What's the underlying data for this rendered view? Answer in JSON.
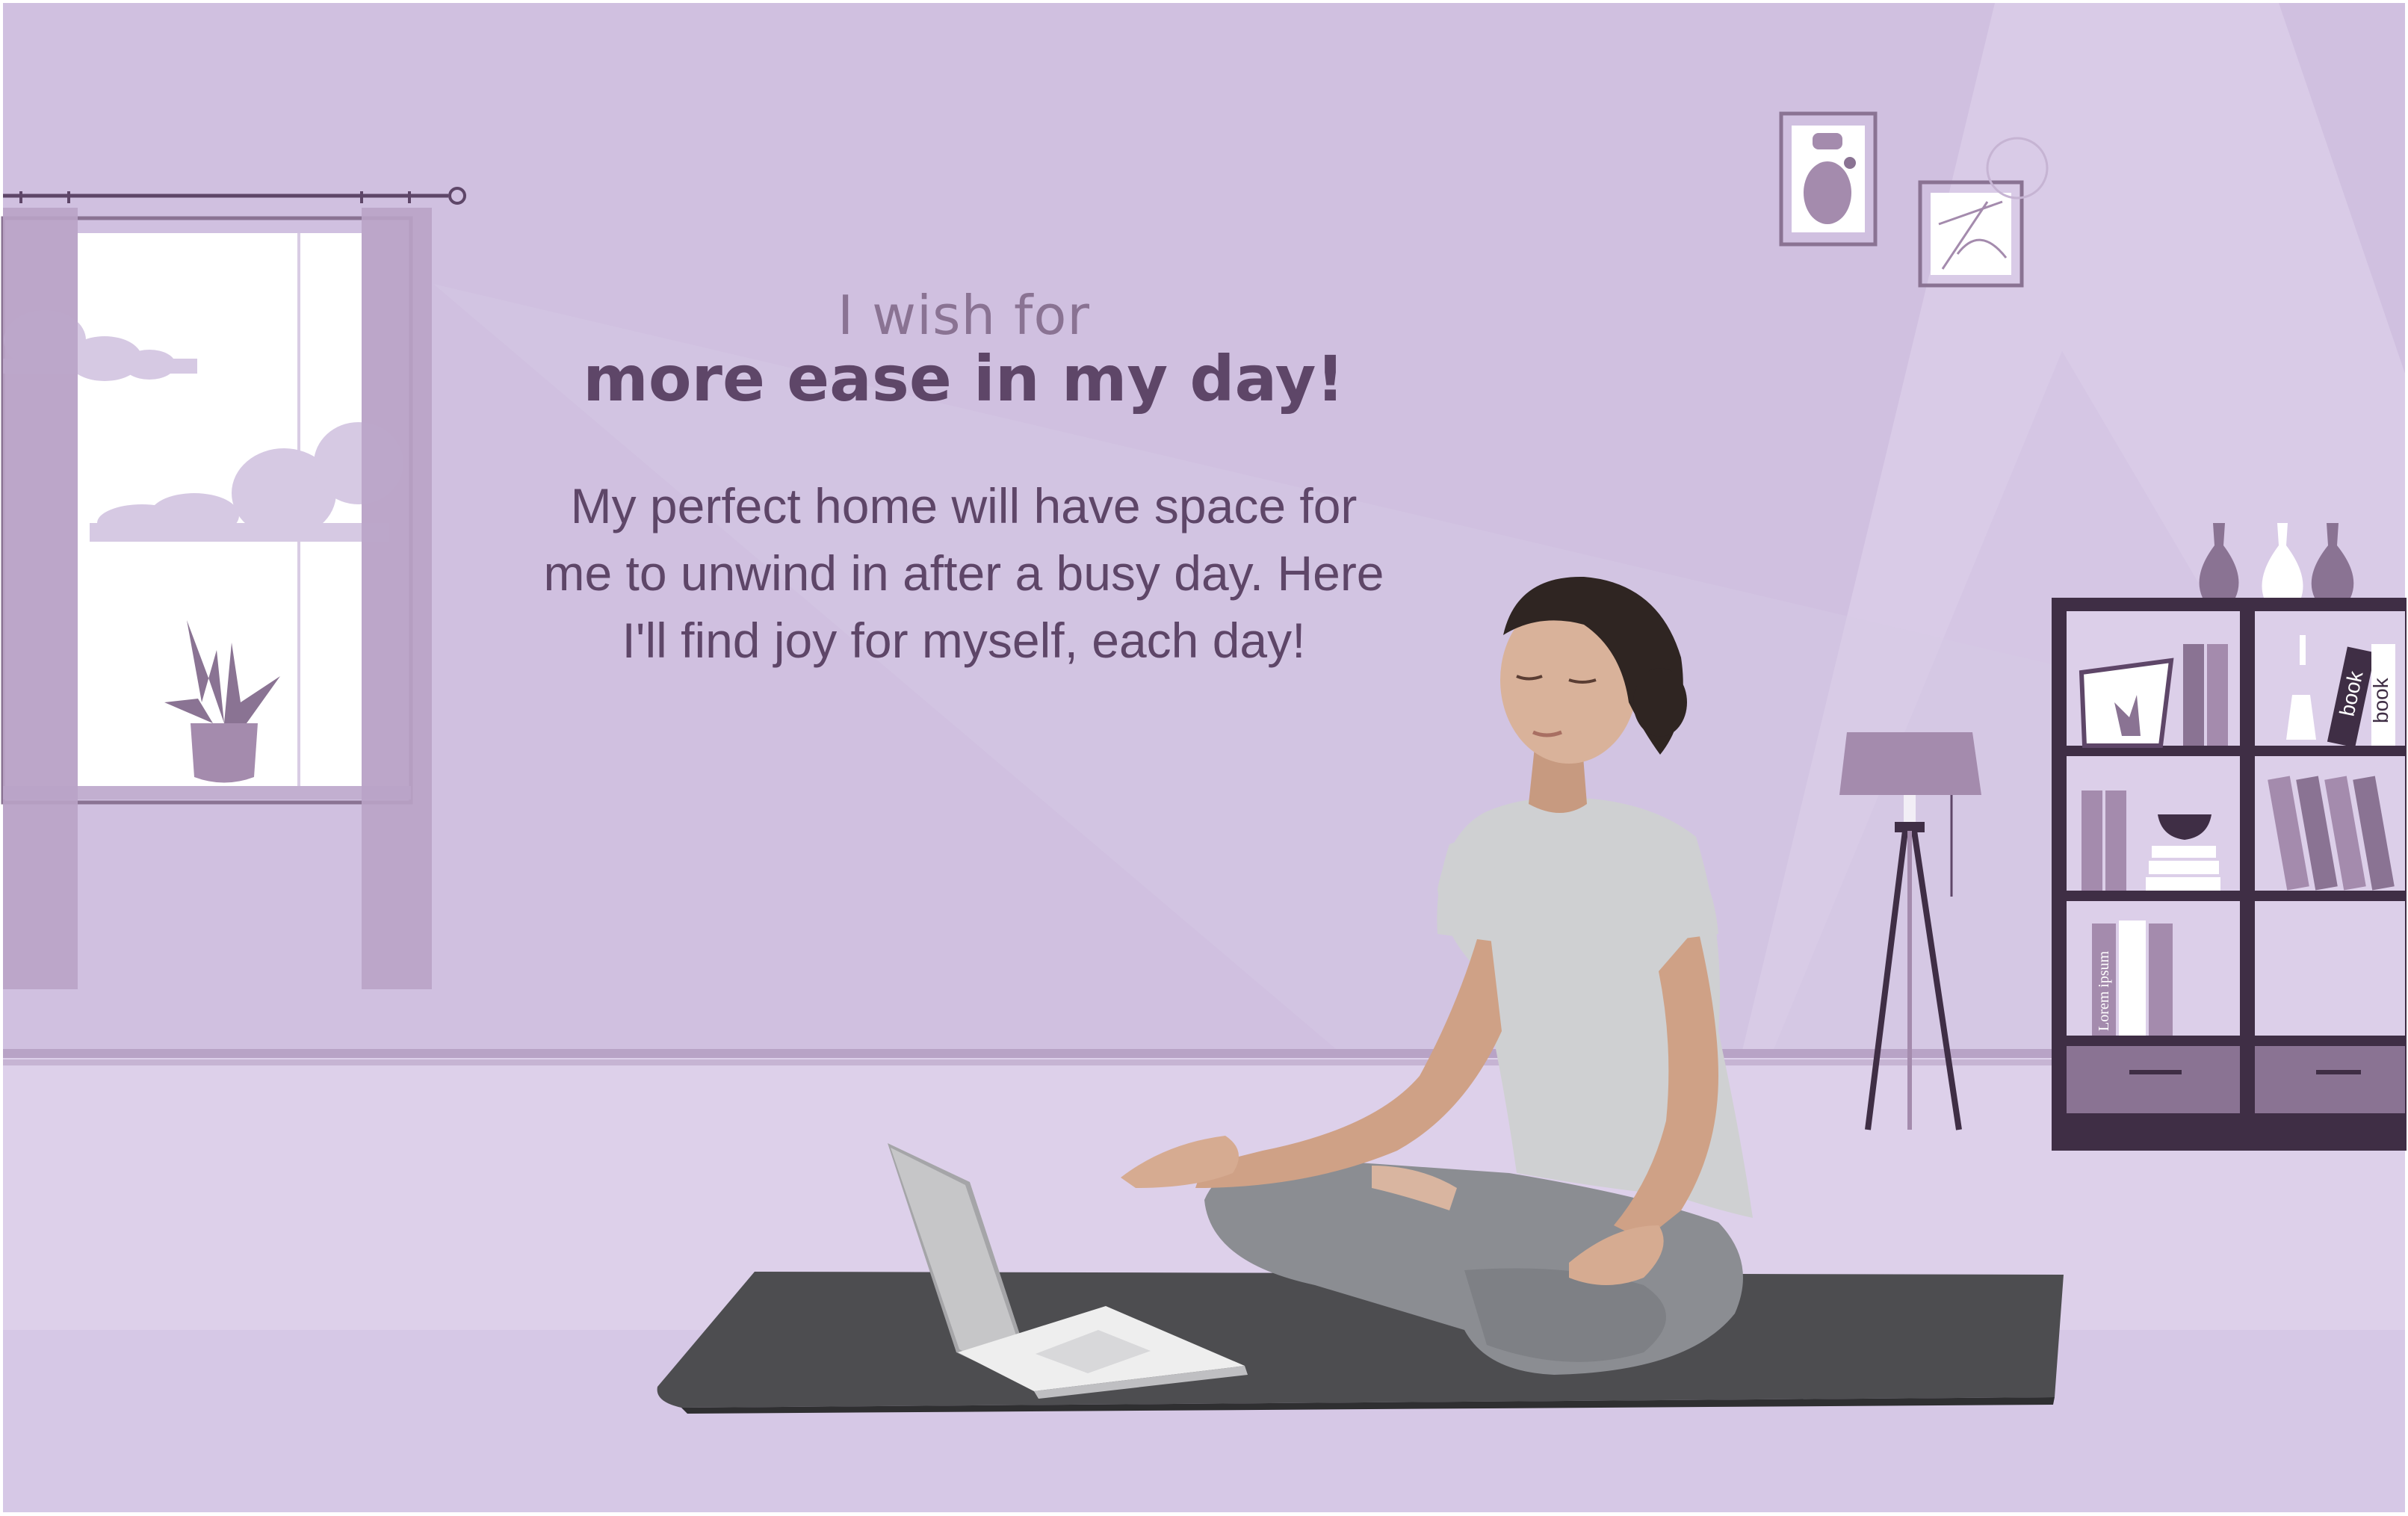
{
  "headline": {
    "line1": "I wish for",
    "line2": "more ease in my day!"
  },
  "body": {
    "lines": [
      "My perfect home will have space for",
      "me to unwind in after a busy day. Here",
      "I'll find joy for myself, each day!"
    ]
  },
  "bookshelf": {
    "book_labels": [
      "Lorem ipsum",
      "book"
    ]
  },
  "colors": {
    "wall": "#d0c0e0",
    "floor": "#ddd0ea",
    "accent_dark": "#3f2e45",
    "accent_mid": "#a98fb3",
    "text_dark": "#5e4668",
    "text_light": "#8a7393"
  }
}
